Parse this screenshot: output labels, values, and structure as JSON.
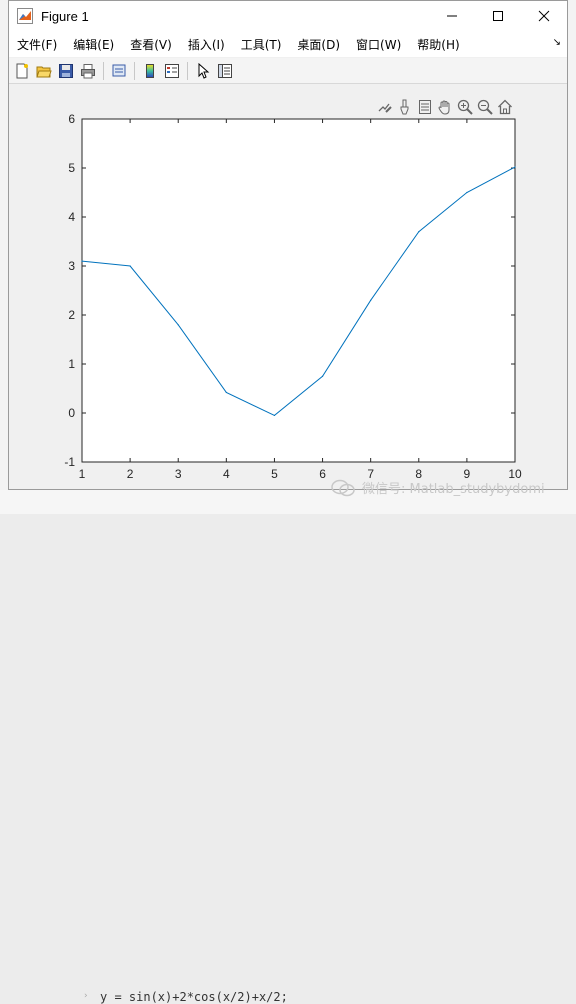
{
  "window": {
    "title": "Figure 1"
  },
  "menu": [
    "文件(F)",
    "编辑(E)",
    "查看(V)",
    "插入(I)",
    "工具(T)",
    "桌面(D)",
    "窗口(W)",
    "帮助(H)"
  ],
  "toolbar_icons": [
    "new-figure-icon",
    "open-file-icon",
    "save-icon",
    "print-icon",
    "print-preview-icon",
    "colorbar-icon",
    "legend-icon",
    "pointer-icon",
    "property-inspector-icon"
  ],
  "axes_toolbar_icons": [
    "edit-icon",
    "brush-icon",
    "data-tips-icon",
    "pan-hand-icon",
    "zoom-in-icon",
    "zoom-out-icon",
    "home-icon"
  ],
  "chart_data": {
    "type": "line",
    "x": [
      1,
      2,
      3,
      4,
      5,
      6,
      7,
      8,
      9,
      10
    ],
    "series": [
      {
        "values": [
          3.1,
          3.0,
          1.8,
          0.42,
          -0.05,
          0.75,
          2.3,
          3.7,
          4.5,
          5.02
        ],
        "color": "#0072bd"
      }
    ],
    "xlim": [
      1,
      10
    ],
    "ylim": [
      -1,
      6
    ],
    "xticks": [
      "1",
      "2",
      "3",
      "4",
      "5",
      "6",
      "7",
      "8",
      "9",
      "10"
    ],
    "yticks": [
      "-1",
      "0",
      "1",
      "2",
      "3",
      "4",
      "5",
      "6"
    ],
    "grid": false
  },
  "background": {
    "code_line": "y = sin(x)+2*cos(x/2)+x/2;"
  },
  "watermark": {
    "text": "微信号: Matlab_studybydomi"
  },
  "colors": {
    "line": "#0072bd",
    "titlebar": "#ffffff",
    "canvas": "#f0f0f0"
  }
}
